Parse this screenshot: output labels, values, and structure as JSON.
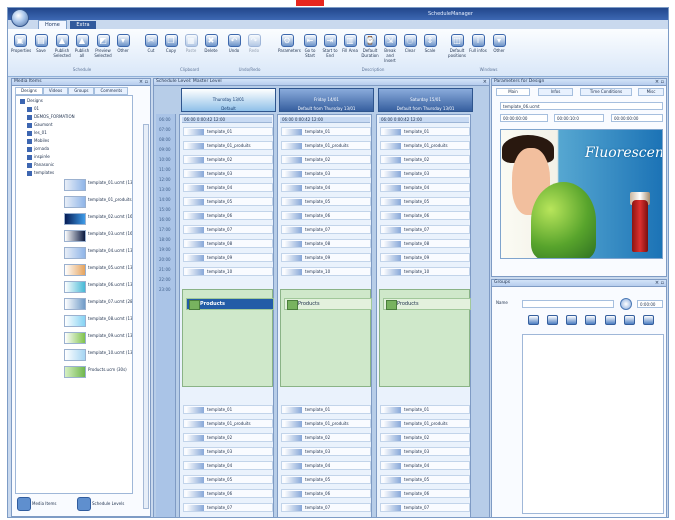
{
  "window": {
    "title": "ScheduleManager"
  },
  "ribbon": {
    "tabs": [
      "Home",
      "Extra"
    ],
    "buttons": [
      "Properties",
      "Save",
      "Publish Selected",
      "Publish all",
      "Preview Selected",
      "Other",
      "Cut",
      "Copy",
      "Paste",
      "Delete",
      "Undo",
      "Redo",
      "Parameters",
      "Go to Start",
      "Start to End",
      "Fill Area",
      "Default Duration",
      "Break and Insert",
      "Clear",
      "Scale",
      "Default positions",
      "Full infos",
      "Other"
    ],
    "groups": [
      "Schedule",
      "Clipboard",
      "Undo/Redo",
      "Description",
      "Windows"
    ]
  },
  "media_items": {
    "title": "Media Items",
    "tabs": [
      "Designs",
      "Videos",
      "Groups",
      "Comments"
    ],
    "tree": [
      "Designs",
      "01",
      "DEMOS_FORMATION",
      "Gaumont",
      "les_01",
      "Mobiles",
      "jornada",
      "inspirée",
      "Panasonic",
      "templates"
    ],
    "files": [
      "template_01.ucmt (13s)",
      "template_01_produits.ucm",
      "template_02.ucmt (16s)",
      "template_03.ucmt (16s)",
      "template_04.ucmt (13s)",
      "template_05.ucmt (13s)",
      "template_06.ucmt (13s)",
      "template_07.ucmt (28s)",
      "template_08.ucmt (13s)",
      "template_09.ucmt (13s)",
      "template_10.ucmt (13s)",
      "Products.ucm (30s)"
    ]
  },
  "bottom_tabs": [
    "Media Items",
    "Schedule Levels"
  ],
  "schedule": {
    "title": "Schedule Level: Master Level",
    "times": [
      "06:00",
      "07:00",
      "08:00",
      "09:00",
      "10:00",
      "11:00",
      "12:00",
      "13:00",
      "14:00",
      "15:00",
      "16:00",
      "17:00",
      "18:00",
      "19:00",
      "20:00",
      "21:00",
      "22:00",
      "23:00"
    ],
    "days": [
      {
        "name": "Thursday 13/01",
        "note": "Default"
      },
      {
        "name": "Friday 14/01",
        "note": "Default from Thursday 13/01"
      },
      {
        "name": "Saturday 15/01",
        "note": "Default from Thursday 13/01"
      }
    ],
    "time_strip": [
      "06:00",
      "0:00:42",
      "12:00"
    ],
    "items": [
      "template_01",
      "template_01_produits",
      "template_02",
      "template_03",
      "template_04",
      "template_05",
      "template_06",
      "template_07",
      "template_08",
      "template_09",
      "template_10"
    ],
    "products": [
      "Products",
      "Products",
      "Products"
    ]
  },
  "design_parameters": {
    "title": "Parameters for Design",
    "tabs": [
      "Main",
      "Infos",
      "Time Conditions",
      "Misc"
    ],
    "file": "template_06.ucmt",
    "time_fields": [
      "00:00:00:00",
      "00:00:10:0",
      "00:00:00:00"
    ],
    "brand": "Fluorescence"
  },
  "group": {
    "title": "Groups",
    "name_label": "Name",
    "duration": "0:00:00"
  }
}
